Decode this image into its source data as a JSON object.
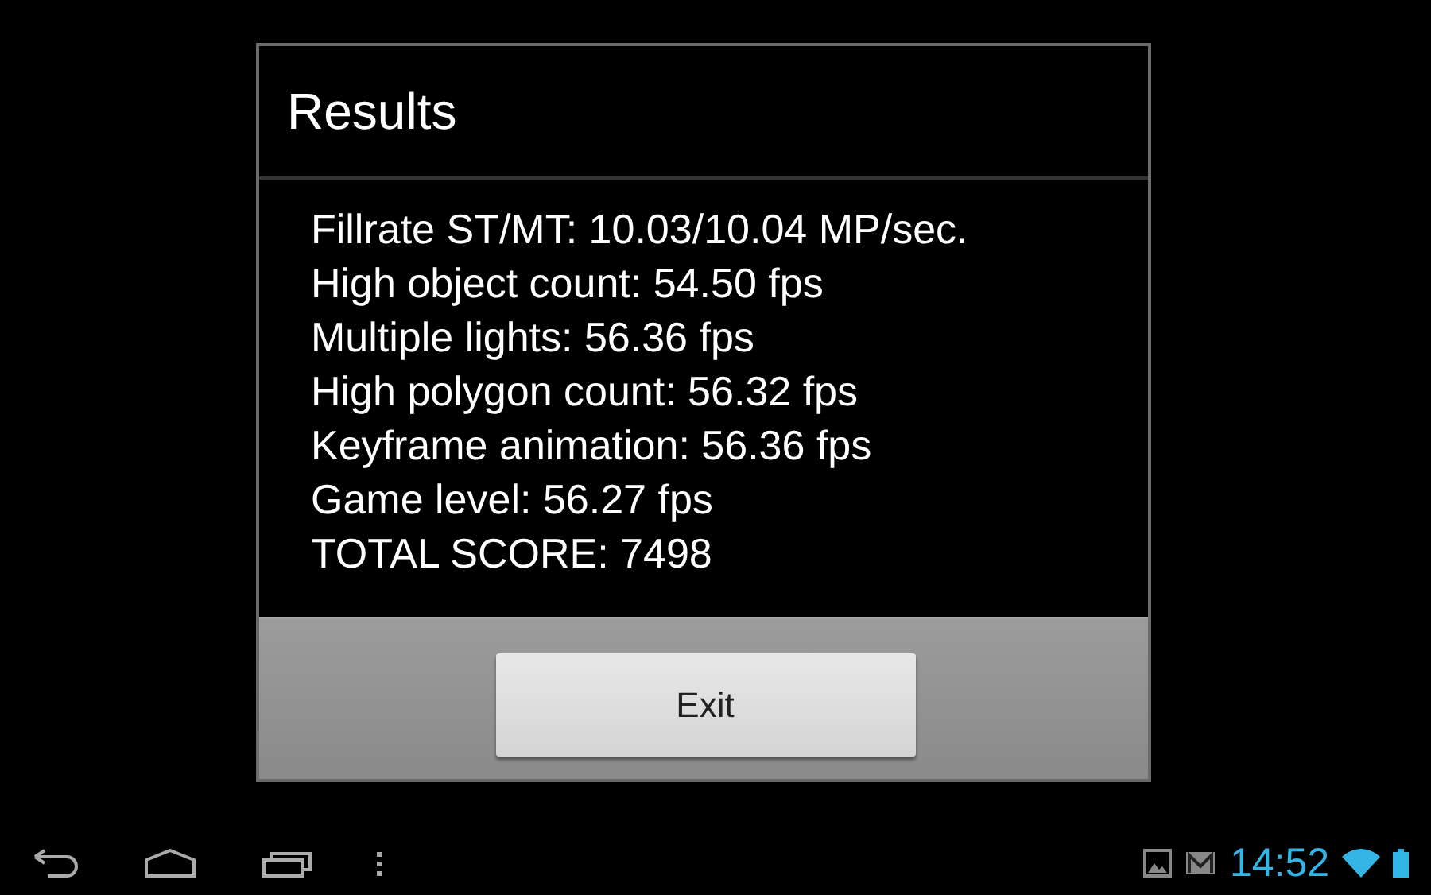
{
  "dialog": {
    "title": "Results",
    "lines": [
      "Fillrate ST/MT: 10.03/10.04 MP/sec.",
      "High object count: 54.50 fps",
      "Multiple lights: 56.36 fps",
      "High polygon count: 56.32 fps",
      "Keyframe animation: 56.36 fps",
      "Game level: 56.27 fps",
      "TOTAL SCORE: 7498"
    ],
    "buttons": [
      "Exit"
    ]
  },
  "status_bar": {
    "time": "14:52"
  }
}
